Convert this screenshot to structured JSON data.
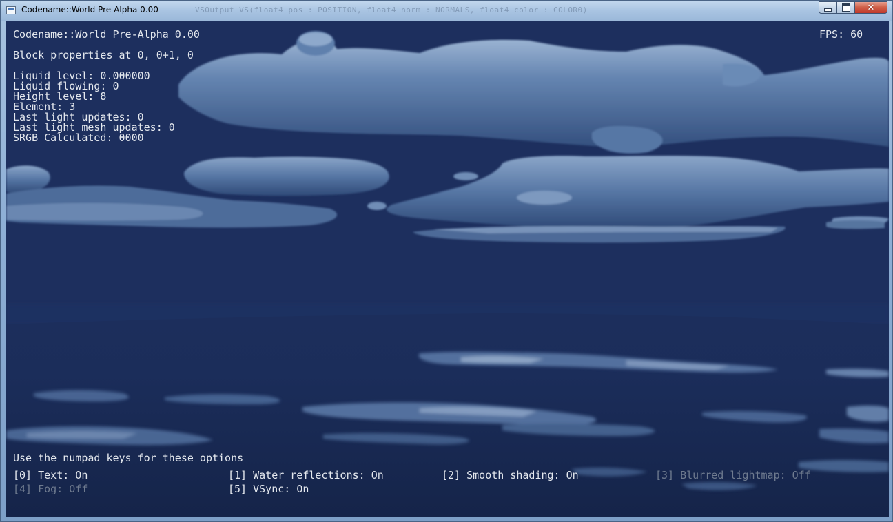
{
  "window": {
    "title": "Codename::World Pre-Alpha 0.00",
    "background_code": "VSOutput VS(float4 pos : POSITION, float4 norm : NORMALS, float4 color : COLOR0)"
  },
  "hud": {
    "game_title": "Codename::World Pre-Alpha 0.00",
    "fps": "FPS: 60",
    "block_header": "Block properties at 0, 0+1, 0",
    "properties": [
      "Liquid level: 0.000000",
      "Liquid flowing: 0",
      "Height level: 8",
      "Element: 3",
      "Last light updates: 0",
      "Last light mesh updates: 0",
      "SRGB Calculated: 0000"
    ],
    "options_header": "Use the numpad keys for these options",
    "options": [
      {
        "label": "[0] Text: On",
        "enabled": true
      },
      {
        "label": "[1] Water reflections: On",
        "enabled": true
      },
      {
        "label": "[2] Smooth shading: On",
        "enabled": true
      },
      {
        "label": "[3] Blurred lightmap: Off",
        "enabled": false
      },
      {
        "label": "[4] Fog: Off",
        "enabled": false
      },
      {
        "label": "[5] VSync: On",
        "enabled": true
      }
    ]
  },
  "colors": {
    "sky": "#1d2f5e",
    "cloud": "#4f6f9c",
    "cloud_highlight": "#9ab3d2",
    "water": "#172650",
    "hud_text": "#e4e8ee",
    "hud_text_disabled": "#6f7b8f"
  }
}
